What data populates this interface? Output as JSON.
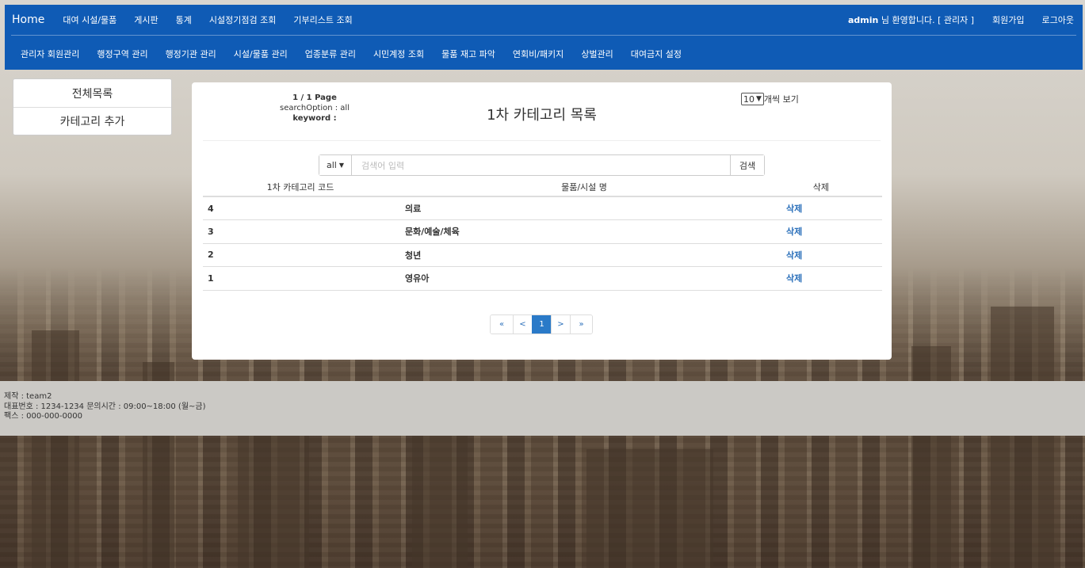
{
  "nav_top": {
    "home": "Home",
    "items": [
      "대여 시설/물품",
      "게시판",
      "통계",
      "시설정기점검 조회",
      "기부리스트 조회"
    ],
    "greeting_user": "admin",
    "greeting_rest": " 님 환영합니다. [ 관리자 ]",
    "signup": "회원가입",
    "logout": "로그아웃"
  },
  "nav_admin": {
    "items": [
      "관리자 회원관리",
      "행정구역 관리",
      "행정기관 관리",
      "시설/물품 관리",
      "업종분류 관리",
      "시민계정 조회",
      "물품 재고 파악",
      "연회비/패키지",
      "상벌관리",
      "대여금지 설정"
    ]
  },
  "side": {
    "items": [
      "전체목록",
      "카테고리 추가"
    ]
  },
  "panel": {
    "title": "1차 카테고리 목록",
    "page_info": "1 / 1 Page",
    "search_option": "searchOption : all",
    "keyword": "keyword :",
    "per_page_value": "10",
    "per_page_label": "개씩 보기",
    "search": {
      "option": "all",
      "placeholder": "검색어 입력",
      "button": "검색"
    },
    "columns": [
      "1차 카테고리 코드",
      "물품/시설 명",
      "삭제"
    ],
    "rows": [
      {
        "code": "4",
        "name": "의료",
        "action": "삭제"
      },
      {
        "code": "3",
        "name": "문화/예술/체육",
        "action": "삭제"
      },
      {
        "code": "2",
        "name": "청년",
        "action": "삭제"
      },
      {
        "code": "1",
        "name": "영유아",
        "action": "삭제"
      }
    ],
    "pagination": [
      "«",
      "<",
      "1",
      ">",
      "»"
    ]
  },
  "footer": {
    "line1": "제작 : team2",
    "line2": "대표번호 : 1234-1234 문의시간 : 09:00~18:00 (월~금)",
    "line3": "팩스 : 000-000-0000"
  }
}
